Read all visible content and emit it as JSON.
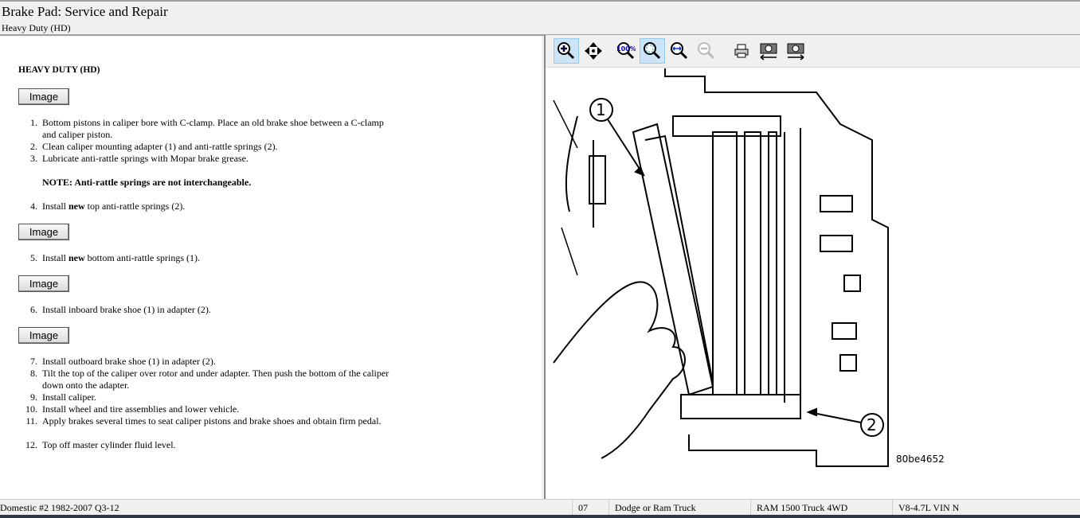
{
  "header": {
    "title": "Brake Pad:  Service and Repair",
    "subtitle": "Heavy Duty (HD)"
  },
  "content": {
    "heading": "HEAVY DUTY (HD)",
    "image_button": "Image",
    "steps": [
      {
        "n": "1.",
        "text": "Bottom pistons in caliper bore with C-clamp. Place an old brake shoe between a C-clamp and caliper piston."
      },
      {
        "n": "2.",
        "text": "Clean caliper mounting adapter (1) and anti-rattle springs (2)."
      },
      {
        "n": "3.",
        "text": "Lubricate anti-rattle springs with Mopar brake grease."
      },
      {
        "n": "4.",
        "text_before": "Install ",
        "bold": "new",
        "text_after": " top anti-rattle springs (2)."
      },
      {
        "n": "5.",
        "text_before": "Install ",
        "bold": "new",
        "text_after": " bottom anti-rattle springs (1)."
      },
      {
        "n": "6.",
        "text": "Install inboard brake shoe (1) in adapter (2)."
      },
      {
        "n": "7.",
        "text": "Install outboard brake shoe (1) in adapter (2)."
      },
      {
        "n": "8.",
        "text": "Tilt the top of the caliper over rotor and under adapter. Then push the bottom of the caliper down onto the adapter."
      },
      {
        "n": "9.",
        "text": "Install caliper."
      },
      {
        "n": "10.",
        "text": "Install wheel and tire assemblies and lower vehicle."
      },
      {
        "n": "11.",
        "text": "Apply brakes several times to seat caliper pistons and brake shoes and obtain firm pedal."
      },
      {
        "n": "12.",
        "text": "Top off master cylinder fluid level."
      }
    ],
    "note": "NOTE: Anti-rattle springs are not interchangeable."
  },
  "viewer": {
    "toolbar": [
      "zoom-in",
      "pan",
      "zoom-100",
      "zoom-fit",
      "zoom-width",
      "zoom-out",
      "print",
      "previous-image",
      "next-image"
    ],
    "callouts": [
      "1",
      "2"
    ],
    "figure_id": "80be4652"
  },
  "status": {
    "db": "Domestic #2 1982-2007 Q3-12",
    "year": "07",
    "make": "Dodge or Ram Truck",
    "model": "RAM 1500 Truck 4WD",
    "engine": "V8-4.7L VIN N"
  }
}
